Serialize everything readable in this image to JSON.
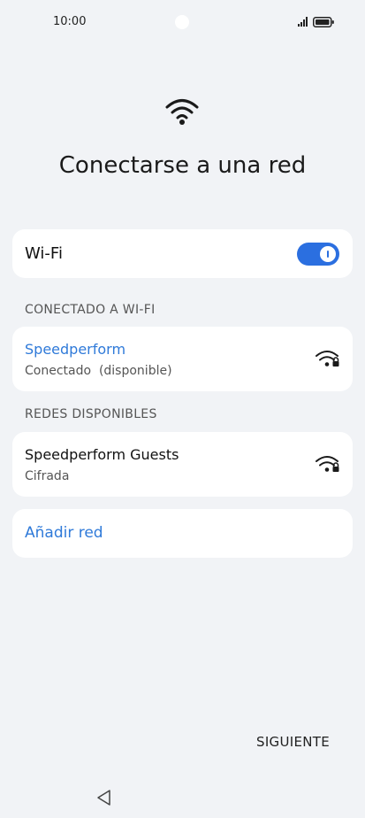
{
  "status": {
    "time": "10:00"
  },
  "page": {
    "title": "Conectarse a una red"
  },
  "wifi_toggle": {
    "label": "Wi-Fi",
    "state": "on"
  },
  "sections": {
    "connected": "CONECTADO A WI-FI",
    "available": "REDES DISPONIBLES"
  },
  "connected_network": {
    "name": "Speedperform",
    "status": "Conectado  (disponible)",
    "icon": "wifi-lock-icon"
  },
  "available_networks": [
    {
      "name": "Speedperform Guests",
      "status": "Cifrada",
      "icon": "wifi-lock-icon"
    }
  ],
  "add_network": {
    "label": "Añadir red"
  },
  "footer": {
    "next_label": "SIGUIENTE"
  },
  "colors": {
    "accent": "#2b6fe0",
    "link": "#2f7ad9",
    "background": "#f1f3f6"
  }
}
